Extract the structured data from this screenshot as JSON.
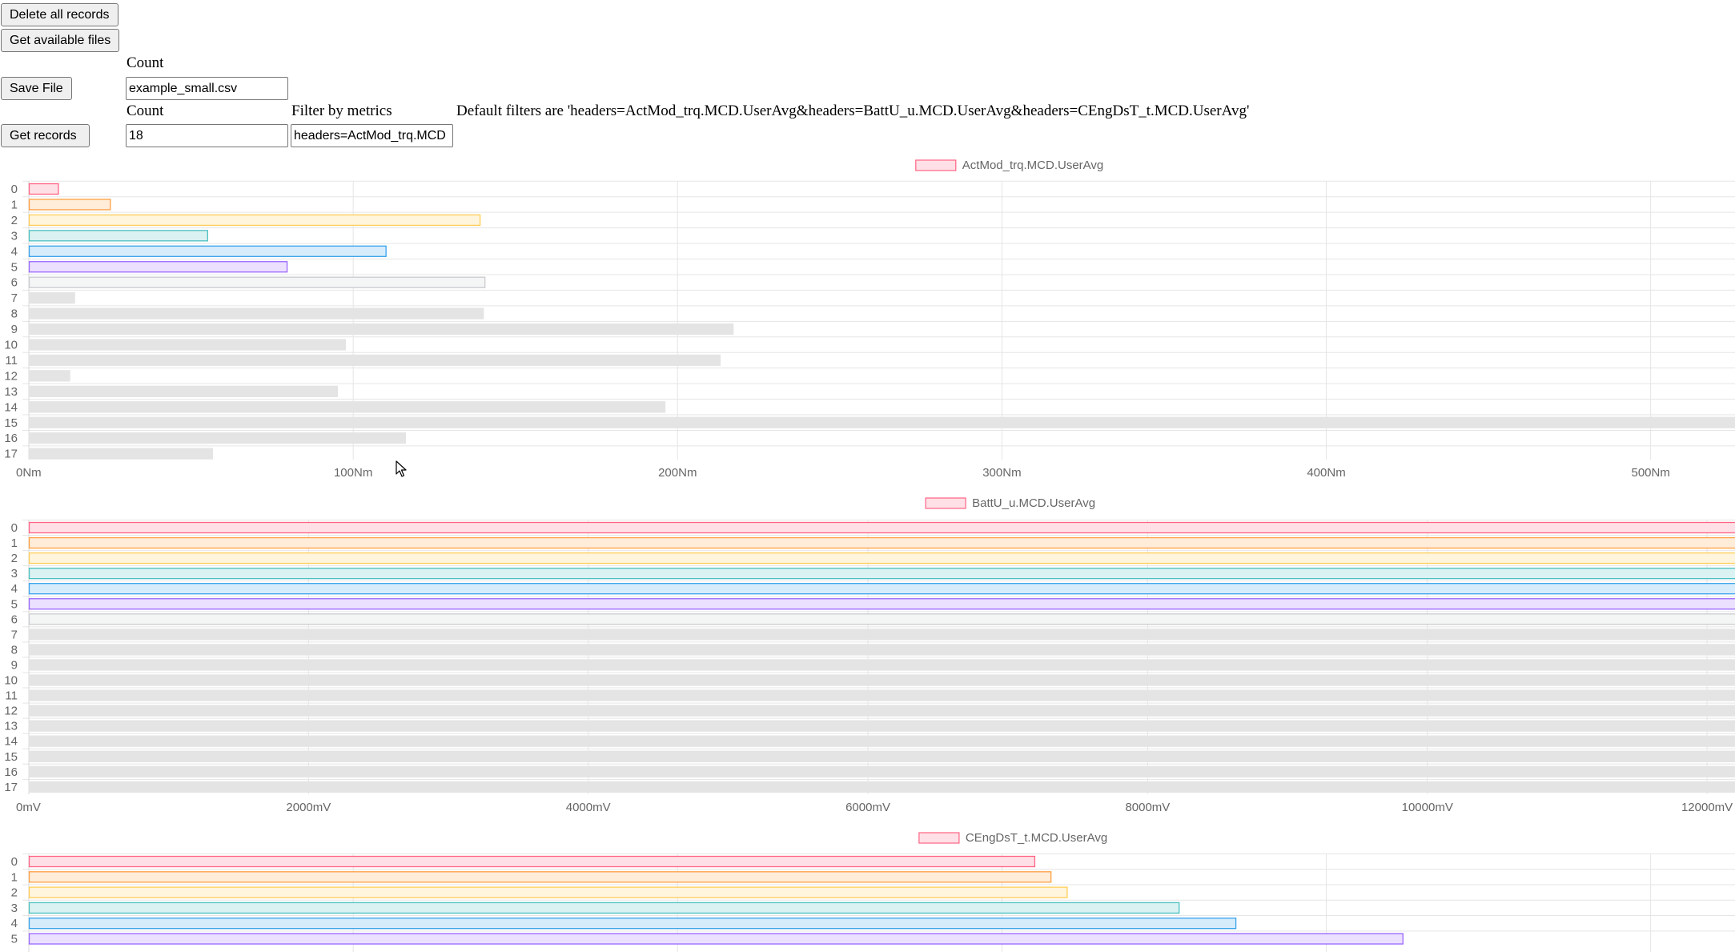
{
  "controls": {
    "delete_all_label": "Delete all records",
    "get_files_label": "Get available files",
    "save_file_label": "Save File",
    "save_count_label": "Count",
    "save_file_value": "example_small.csv",
    "get_records_label": "Get records",
    "records_count_label": "Count",
    "records_count_value": "18",
    "filter_label": "Filter by metrics",
    "filter_value": "headers=ActMod_trq.MCD",
    "default_filters_text": "Default filters are 'headers=ActMod_trq.MCD.UserAvg&headers=BattU_u.MCD.UserAvg&headers=CEngDsT_t.MCD.UserAvg'"
  },
  "palette": {
    "bar_fills": [
      "#ffe0e6",
      "#ffecd9",
      "#fff5dd",
      "#dbf2f2",
      "#d7ecfb",
      "#ebe0ff",
      "#f4f5f5",
      "#e4e4e4"
    ],
    "bar_borders": [
      "#ff6384",
      "#ff9f40",
      "#ffcd56",
      "#4bc0c0",
      "#36a2eb",
      "#9966ff",
      "#c9cbcf",
      "#e4e4e4"
    ],
    "grid": "#e5e5e5",
    "tick_text": "#666666"
  },
  "chart_data": [
    {
      "type": "bar",
      "orientation": "horizontal",
      "legend": "ActMod_trq.MCD.UserAvg",
      "categories": [
        "0",
        "1",
        "2",
        "3",
        "4",
        "5",
        "6",
        "7",
        "8",
        "9",
        "10",
        "11",
        "12",
        "13",
        "14",
        "15",
        "16",
        "17"
      ],
      "values": [
        9,
        25,
        139,
        55,
        110,
        79.5,
        140.5,
        14,
        140,
        217,
        97.5,
        213,
        12.5,
        95,
        196,
        530,
        116,
        56.5
      ],
      "xlim": [
        0,
        526
      ],
      "x_ticks": [
        0,
        100,
        200,
        300,
        400,
        500
      ],
      "x_tick_labels": [
        "0Nm",
        "100Nm",
        "200Nm",
        "300Nm",
        "400Nm",
        "500Nm"
      ],
      "grid": true,
      "legend_position": "top"
    },
    {
      "type": "bar",
      "orientation": "horizontal",
      "legend": "BattU_u.MCD.UserAvg",
      "categories": [
        "0",
        "1",
        "2",
        "3",
        "4",
        "5",
        "6",
        "7",
        "8",
        "9",
        "10",
        "11",
        "12",
        "13",
        "14",
        "15",
        "16",
        "17"
      ],
      "values": [
        12500,
        12500,
        12500,
        12500,
        12500,
        12500,
        12500,
        12500,
        12500,
        12500,
        12500,
        12500,
        12500,
        12500,
        12500,
        12500,
        12500,
        12500
      ],
      "xlim": [
        0,
        12200
      ],
      "x_ticks": [
        0,
        2000,
        4000,
        6000,
        8000,
        10000,
        12000
      ],
      "x_tick_labels": [
        "0mV",
        "2000mV",
        "4000mV",
        "6000mV",
        "8000mV",
        "10000mV",
        "12000mV"
      ],
      "grid": true,
      "legend_position": "top"
    },
    {
      "type": "bar",
      "orientation": "horizontal",
      "legend": "CEngDsT_t.MCD.UserAvg",
      "categories": [
        "0",
        "1",
        "2",
        "3",
        "4",
        "5"
      ],
      "values": [
        310,
        315,
        320,
        354.5,
        372,
        423.5
      ],
      "xlim": [
        0,
        526
      ],
      "x_ticks": [
        0,
        100,
        200,
        300,
        400,
        500
      ],
      "grid": true,
      "legend_position": "top"
    }
  ]
}
